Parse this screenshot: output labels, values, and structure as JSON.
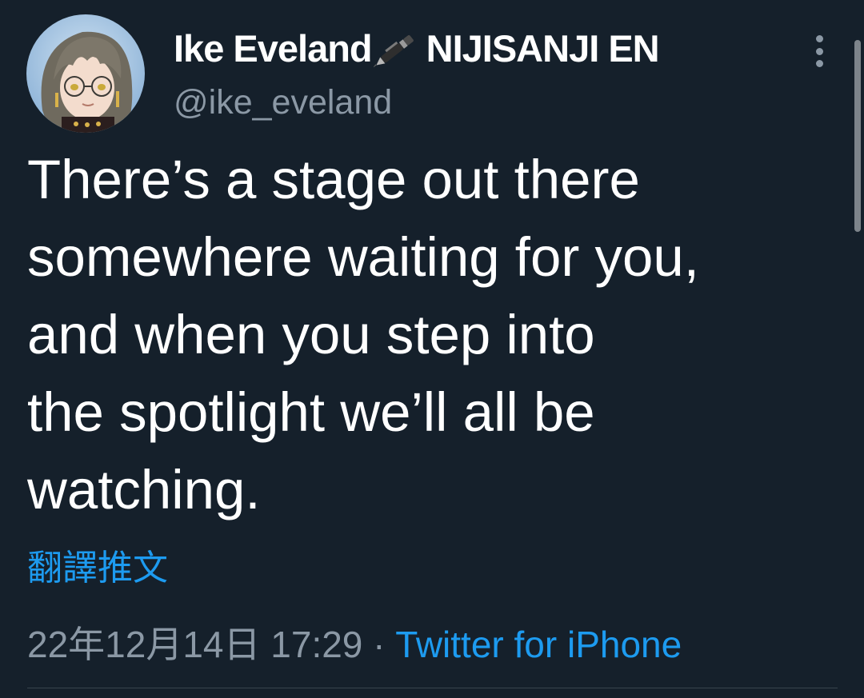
{
  "tweet": {
    "author": {
      "display_name_part1": "Ike Eveland",
      "display_name_emoji": "fountain-pen-icon",
      "display_name_part2": "NIJISANJI EN",
      "handle": "@ike_eveland"
    },
    "text_lines": [
      "There’s a stage out there",
      "somewhere waiting for you,",
      "and when you step into",
      "the spotlight we’ll all be",
      "watching."
    ],
    "translate_label": "翻譯推文",
    "timestamp": "22年12月14日 17:29",
    "separator": " · ",
    "source": "Twitter for iPhone"
  },
  "colors": {
    "background": "#15202b",
    "text": "#ffffff",
    "secondary_text": "#8b98a5",
    "accent": "#1d9bf0"
  }
}
